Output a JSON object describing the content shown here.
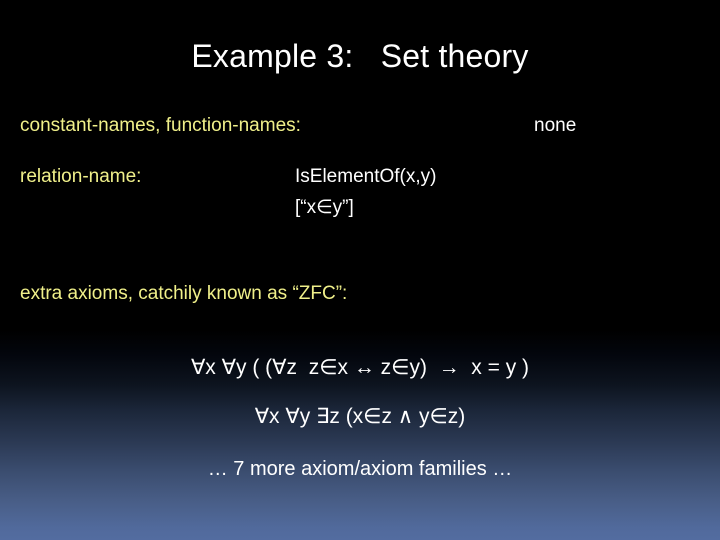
{
  "slide": {
    "title": "Example 3:   Set theory",
    "colors": {
      "background_top": "#000000",
      "background_bottom": "#536ca0",
      "label_yellow": "#f0f08a",
      "value_white": "#ffffff"
    },
    "signature_rows": [
      {
        "label": "constant-names, function-names:",
        "value": "none"
      },
      {
        "label": "relation-name:",
        "value_line1": "IsElementOf(x,y)",
        "value_line2": "[“x∈y”]"
      }
    ],
    "axioms_heading": "extra axioms, catchily known as “ZFC”:",
    "axioms": [
      "∀x ∀y ( (∀z  z∈x ↔ z∈y)  →  x = y )",
      "∀x ∀y ∃z (x∈z ∧ y∈z)",
      "… 7 more axiom/axiom families …"
    ]
  }
}
